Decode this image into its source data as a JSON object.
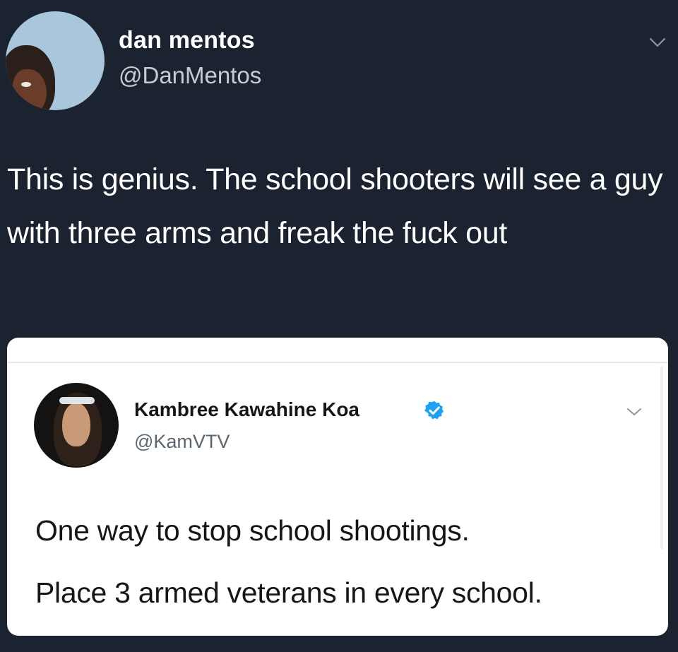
{
  "outer_tweet": {
    "display_name": "dan mentos",
    "handle": "@DanMentos",
    "text": "This is genius. The school shooters will see a guy with three arms and freak the fuck out",
    "avatar_icon": "profile-photo",
    "menu_icon": "chevron-down-icon"
  },
  "quoted_tweet": {
    "display_name": "Kambree Kawahine Koa",
    "verified": true,
    "verified_icon": "verified-badge-icon",
    "verified_color": "#1da1f2",
    "handle": "@KamVTV",
    "lines": [
      "One way to stop school shootings.",
      "Place 3 armed veterans in every school."
    ],
    "menu_icon": "chevron-down-icon"
  },
  "colors": {
    "background": "#1b2230",
    "card": "#ffffff",
    "primary_text_dark": "#ffffff",
    "secondary_text_dark": "#c7ccd3",
    "primary_text_light": "#14171a",
    "secondary_text_light": "#5b6770"
  }
}
